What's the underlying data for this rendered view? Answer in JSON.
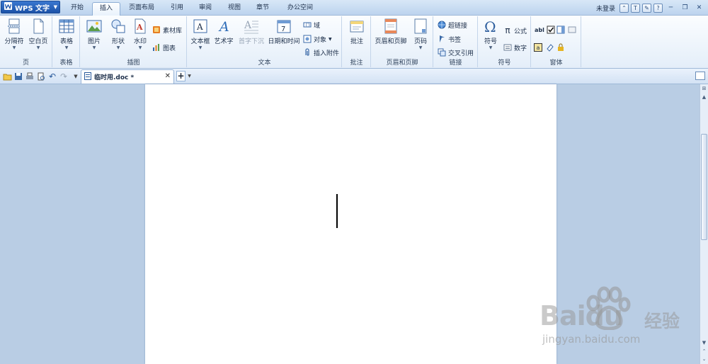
{
  "app": {
    "name": "WPS 文字",
    "document_tab": "临时用.doc *",
    "login_label": "未登录"
  },
  "menu_tabs": [
    "开始",
    "插入",
    "页面布局",
    "引用",
    "审阅",
    "视图",
    "章节",
    "办公空间"
  ],
  "active_tab": "插入",
  "ribbon": {
    "groups": {
      "page": "页",
      "table": "表格",
      "illustration": "插图",
      "text": "文本",
      "comment": "批注",
      "header_footer": "页眉和页脚",
      "link": "链接",
      "symbol": "符号",
      "form": "窗体"
    },
    "buttons": {
      "page_break": "分隔符",
      "blank_page": "空白页",
      "table": "表格",
      "picture": "图片",
      "shape": "形状",
      "watermark": "水印",
      "material_library": "素材库",
      "chart": "图表",
      "textbox": "文本框",
      "wordart": "艺术字",
      "drop_cap": "首字下沉",
      "date_time": "日期和时间",
      "field": "域",
      "object": "对象",
      "insert_attachment": "插入附件",
      "comment": "批注",
      "header_footer": "页眉和页脚",
      "page_number": "页码",
      "hyperlink": "超链接",
      "bookmark": "书签",
      "cross_reference": "交叉引用",
      "symbol": "符号",
      "formula": "公式",
      "number": "数字",
      "form_text_label": "abl"
    }
  },
  "watermark": {
    "brand": "Baidu",
    "text": "经验",
    "url": "jingyan.baidu.com"
  },
  "colors": {
    "accent": "#1c52a8",
    "ribbon_bg": "#e4eef9",
    "canvas_bg": "#b9cde4"
  }
}
